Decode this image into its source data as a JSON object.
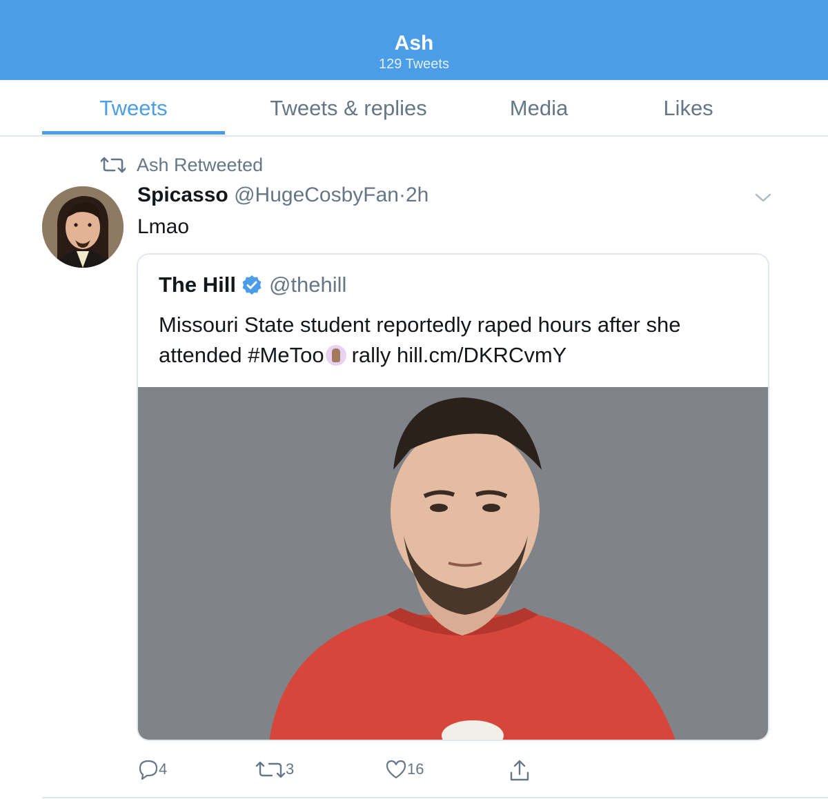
{
  "header": {
    "title": "Ash",
    "subtitle": "129 Tweets",
    "color": "#4a9de6"
  },
  "tabs": [
    {
      "label": "Tweets",
      "active": true
    },
    {
      "label": "Tweets & replies",
      "active": false
    },
    {
      "label": "Media",
      "active": false
    },
    {
      "label": "Likes",
      "active": false
    }
  ],
  "retweet": {
    "label": "Ash Retweeted",
    "icon": "retweet-icon"
  },
  "tweet": {
    "author_name": "Spicasso",
    "author_handle": "@HugeCosbyFan",
    "separator": "·",
    "time": "2h",
    "text": "Lmao",
    "menu_icon": "chevron-down-icon"
  },
  "quote": {
    "name": "The Hill",
    "verified": true,
    "handle": "@thehill",
    "text_part1": "Missouri State student reportedly raped hours after she attended #MeToo",
    "emoji": "raised-hands-emoji",
    "text_part2": "rally hill.cm/DKRCvmY"
  },
  "actions": {
    "reply_count": "4",
    "retweet_count": "3",
    "like_count": "16",
    "share_icon": "share-icon"
  }
}
